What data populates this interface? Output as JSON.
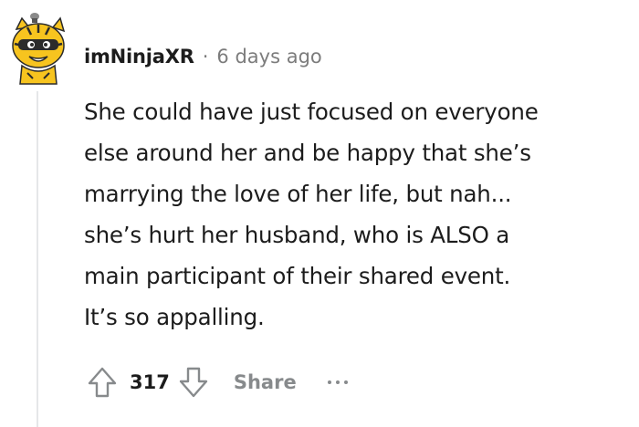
{
  "comment": {
    "author": "imNinjaXR",
    "separator": "·",
    "timestamp": "6 days ago",
    "lines": [
      "She could have just focused on everyone",
      "else around her and be happy that she’s",
      "marrying the love of her life, but nah...",
      "she’s hurt her husband, who is ALSO a",
      "main participant of their shared event.",
      "It’s so appalling."
    ]
  },
  "actions": {
    "score": "317",
    "share_label": "Share",
    "upvote_icon": "arrow-up-outline-icon",
    "downvote_icon": "arrow-down-outline-icon",
    "more_icon": "more-dots-icon"
  },
  "avatar": {
    "icon": "ninja-cat-avatar",
    "primary_color": "#f7c41f",
    "accent_color": "#2b2b2b"
  }
}
